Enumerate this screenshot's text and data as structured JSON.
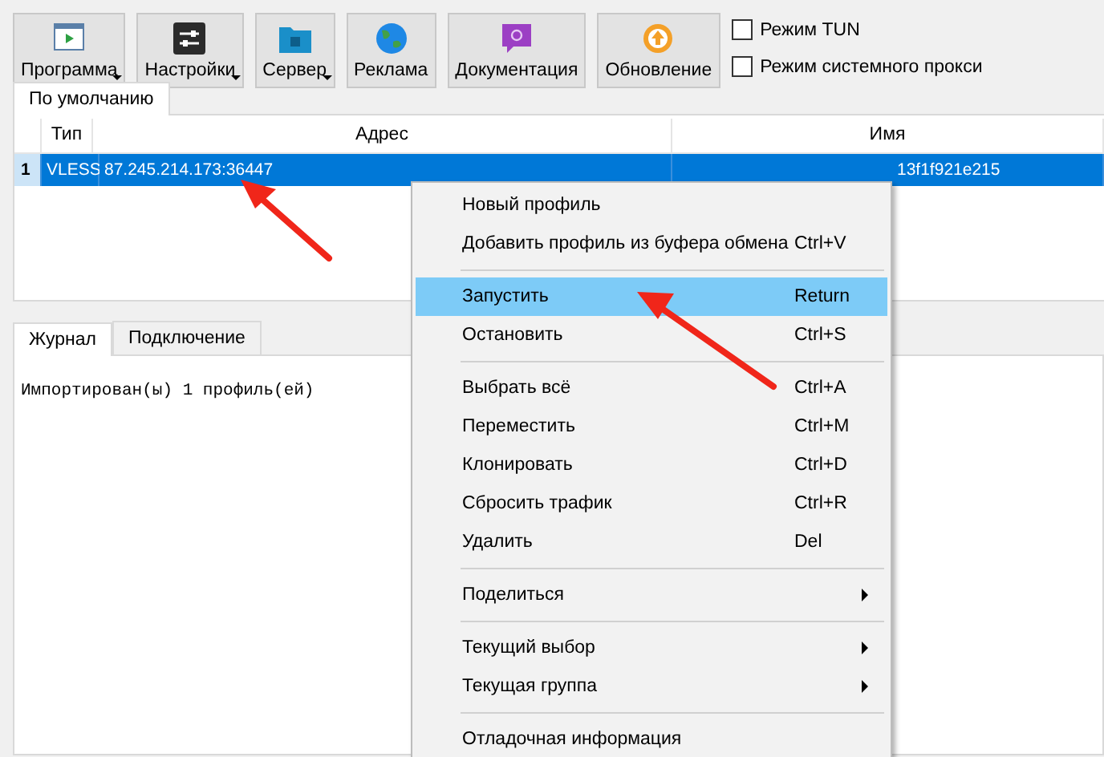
{
  "toolbar": [
    {
      "label": "Программа",
      "dropdown": true
    },
    {
      "label": "Настройки",
      "dropdown": true
    },
    {
      "label": "Сервер",
      "dropdown": true
    },
    {
      "label": "Реклама",
      "dropdown": false
    },
    {
      "label": "Документация",
      "dropdown": false
    },
    {
      "label": "Обновление",
      "dropdown": false
    }
  ],
  "options": [
    {
      "label": "Режим TUN",
      "checked": false
    },
    {
      "label": "Режим системного прокси",
      "checked": false
    }
  ],
  "group_tabs": [
    {
      "label": "По умолчанию",
      "selected": true
    }
  ],
  "table": {
    "columns": [
      "Тип",
      "Адрес",
      "Имя"
    ],
    "rows": [
      {
        "index": "1",
        "type": "VLESS",
        "address": "87.245.214.173:36447",
        "name": "13f1f921e215",
        "selected": true
      }
    ]
  },
  "bottom_tabs": [
    {
      "label": "Журнал",
      "selected": true
    },
    {
      "label": "Подключение",
      "selected": false
    }
  ],
  "log": [
    "Импортирован(ы) 1 профиль(ей)"
  ],
  "context_menu": [
    {
      "kind": "item",
      "label": "Новый профиль",
      "highlighted": false
    },
    {
      "kind": "item",
      "label": "Добавить профиль из буфера обмена",
      "shortcut": "Ctrl+V",
      "highlighted": false
    },
    {
      "kind": "separator"
    },
    {
      "kind": "item",
      "label": "Запустить",
      "shortcut": "Return",
      "highlighted": true
    },
    {
      "kind": "item",
      "label": "Остановить",
      "shortcut": "Ctrl+S",
      "highlighted": false
    },
    {
      "kind": "separator"
    },
    {
      "kind": "item",
      "label": "Выбрать всё",
      "shortcut": "Ctrl+A",
      "highlighted": false
    },
    {
      "kind": "item",
      "label": "Переместить",
      "shortcut": "Ctrl+M",
      "highlighted": false
    },
    {
      "kind": "item",
      "label": "Клонировать",
      "shortcut": "Ctrl+D",
      "highlighted": false
    },
    {
      "kind": "item",
      "label": "Сбросить трафик",
      "shortcut": "Ctrl+R",
      "highlighted": false
    },
    {
      "kind": "item",
      "label": "Удалить",
      "shortcut": "Del",
      "highlighted": false
    },
    {
      "kind": "separator"
    },
    {
      "kind": "submenu",
      "label": "Поделиться",
      "highlighted": false
    },
    {
      "kind": "separator"
    },
    {
      "kind": "submenu",
      "label": "Текущий выбор",
      "highlighted": false
    },
    {
      "kind": "submenu",
      "label": "Текущая группа",
      "highlighted": false
    },
    {
      "kind": "separator"
    },
    {
      "kind": "item",
      "label": "Отладочная информация",
      "highlighted": false
    }
  ]
}
